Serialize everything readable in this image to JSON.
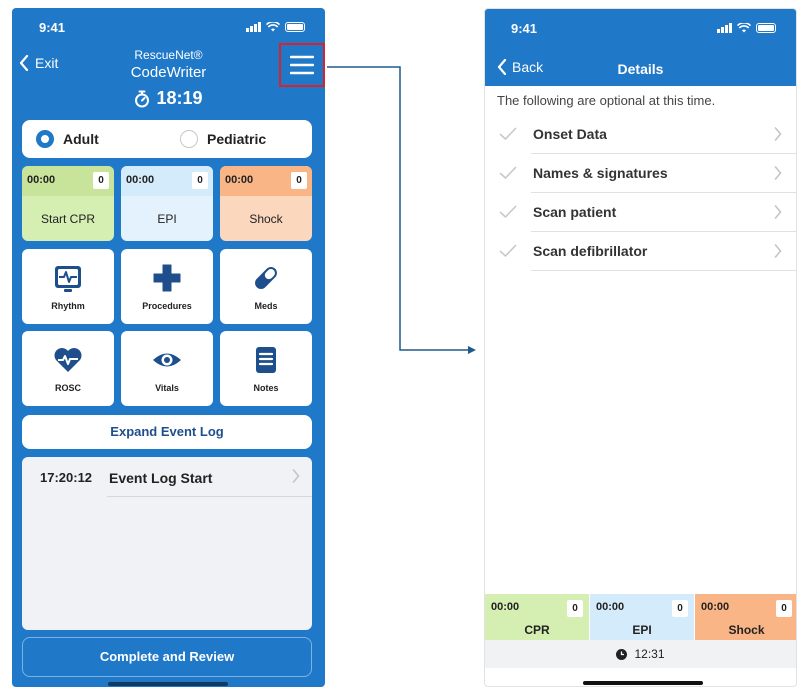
{
  "colors": {
    "primary_blue": "#1f78c8",
    "highlight_red": "#d9232c",
    "cpr_green": "#d5eeb1",
    "cpr_green_dark": "#c7e49a",
    "epi_blue": "#d4ebfb",
    "shock_orange": "#f9b585",
    "shock_orange_light": "#fad7bd",
    "connector": "#1e5a8a"
  },
  "phone1": {
    "status": {
      "time": "9:41"
    },
    "nav": {
      "exit_label": "Exit",
      "title_line1": "RescueNet®",
      "title_line2": "CodeWriter",
      "menu_icon": "hamburger-icon"
    },
    "timer": "18:19",
    "patient_type": {
      "options": [
        "Adult",
        "Pediatric"
      ],
      "selected": "Adult"
    },
    "counters": [
      {
        "time": "00:00",
        "count": "0",
        "label": "Start CPR"
      },
      {
        "time": "00:00",
        "count": "0",
        "label": "EPI"
      },
      {
        "time": "00:00",
        "count": "0",
        "label": "Shock"
      }
    ],
    "tiles": [
      {
        "label": "Rhythm",
        "icon": "ecg-monitor-icon"
      },
      {
        "label": "Procedures",
        "icon": "medical-cross-icon"
      },
      {
        "label": "Meds",
        "icon": "pill-icon"
      },
      {
        "label": "ROSC",
        "icon": "heart-pulse-icon"
      },
      {
        "label": "Vitals",
        "icon": "eye-icon"
      },
      {
        "label": "Notes",
        "icon": "notes-icon"
      }
    ],
    "expand_label": "Expand Event Log",
    "event_log": [
      {
        "time": "17:20:12",
        "text": "Event Log Start"
      }
    ],
    "complete_label": "Complete and Review"
  },
  "phone2": {
    "status": {
      "time": "9:41"
    },
    "nav": {
      "back_label": "Back",
      "title": "Details"
    },
    "intro": "The following are optional at this time.",
    "items": [
      {
        "label": "Onset Data"
      },
      {
        "label": "Names & signatures"
      },
      {
        "label": "Scan patient"
      },
      {
        "label": "Scan defibrillator"
      }
    ],
    "bottom_counters": [
      {
        "time": "00:00",
        "count": "0",
        "label": "CPR"
      },
      {
        "time": "00:00",
        "count": "0",
        "label": "EPI"
      },
      {
        "time": "00:00",
        "count": "0",
        "label": "Shock"
      }
    ],
    "clock": "12:31"
  }
}
